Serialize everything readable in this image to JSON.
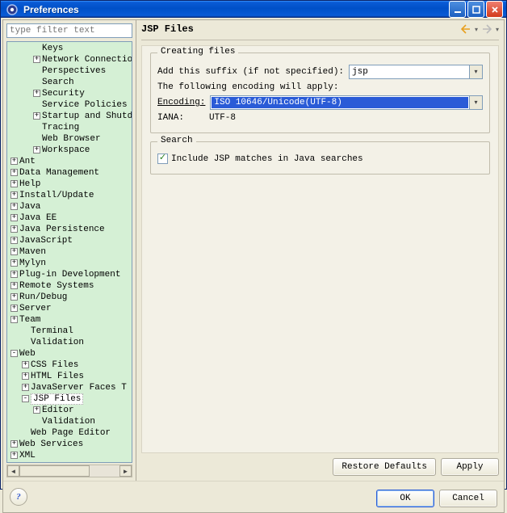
{
  "window": {
    "title": "Preferences"
  },
  "filter": {
    "placeholder": "type filter text"
  },
  "tree": {
    "selected_label": "JSP Files",
    "rows": [
      {
        "indent": 2,
        "tw": "",
        "label": "Keys"
      },
      {
        "indent": 2,
        "tw": "+",
        "label": "Network Connection"
      },
      {
        "indent": 2,
        "tw": "",
        "label": "Perspectives"
      },
      {
        "indent": 2,
        "tw": "",
        "label": "Search"
      },
      {
        "indent": 2,
        "tw": "+",
        "label": "Security"
      },
      {
        "indent": 2,
        "tw": "",
        "label": "Service Policies"
      },
      {
        "indent": 2,
        "tw": "+",
        "label": "Startup and Shutdo"
      },
      {
        "indent": 2,
        "tw": "",
        "label": "Tracing"
      },
      {
        "indent": 2,
        "tw": "",
        "label": "Web Browser"
      },
      {
        "indent": 2,
        "tw": "+",
        "label": "Workspace"
      },
      {
        "indent": 0,
        "tw": "+",
        "label": "Ant"
      },
      {
        "indent": 0,
        "tw": "+",
        "label": "Data Management"
      },
      {
        "indent": 0,
        "tw": "+",
        "label": "Help"
      },
      {
        "indent": 0,
        "tw": "+",
        "label": "Install/Update"
      },
      {
        "indent": 0,
        "tw": "+",
        "label": "Java"
      },
      {
        "indent": 0,
        "tw": "+",
        "label": "Java EE"
      },
      {
        "indent": 0,
        "tw": "+",
        "label": "Java Persistence"
      },
      {
        "indent": 0,
        "tw": "+",
        "label": "JavaScript"
      },
      {
        "indent": 0,
        "tw": "+",
        "label": "Maven"
      },
      {
        "indent": 0,
        "tw": "+",
        "label": "Mylyn"
      },
      {
        "indent": 0,
        "tw": "+",
        "label": "Plug-in Development"
      },
      {
        "indent": 0,
        "tw": "+",
        "label": "Remote Systems"
      },
      {
        "indent": 0,
        "tw": "+",
        "label": "Run/Debug"
      },
      {
        "indent": 0,
        "tw": "+",
        "label": "Server"
      },
      {
        "indent": 0,
        "tw": "+",
        "label": "Team"
      },
      {
        "indent": 1,
        "tw": "",
        "label": "Terminal"
      },
      {
        "indent": 1,
        "tw": "",
        "label": "Validation"
      },
      {
        "indent": 0,
        "tw": "-",
        "label": "Web"
      },
      {
        "indent": 1,
        "tw": "+",
        "label": "CSS Files"
      },
      {
        "indent": 1,
        "tw": "+",
        "label": "HTML Files"
      },
      {
        "indent": 1,
        "tw": "+",
        "label": "JavaServer Faces T"
      },
      {
        "indent": 1,
        "tw": "-",
        "label": "JSP Files",
        "selected": true
      },
      {
        "indent": 2,
        "tw": "+",
        "label": "Editor"
      },
      {
        "indent": 2,
        "tw": "",
        "label": "Validation"
      },
      {
        "indent": 1,
        "tw": "",
        "label": "Web Page Editor"
      },
      {
        "indent": 0,
        "tw": "+",
        "label": "Web Services"
      },
      {
        "indent": 0,
        "tw": "+",
        "label": "XML"
      }
    ]
  },
  "page": {
    "title": "JSP Files",
    "creating": {
      "legend": "Creating files",
      "suffix_label": "Add this suffix (if not specified):",
      "suffix_value": "jsp",
      "encoding_note": "The following encoding will apply:",
      "encoding_label": "Encoding:",
      "encoding_value": "ISO 10646/Unicode(UTF-8)",
      "iana_label": "IANA:",
      "iana_value": "UTF-8"
    },
    "search": {
      "legend": "Search",
      "include_label": "Include JSP matches in Java searches",
      "include_checked": true
    }
  },
  "buttons": {
    "restore": "Restore Defaults",
    "apply": "Apply",
    "ok": "OK",
    "cancel": "Cancel"
  }
}
